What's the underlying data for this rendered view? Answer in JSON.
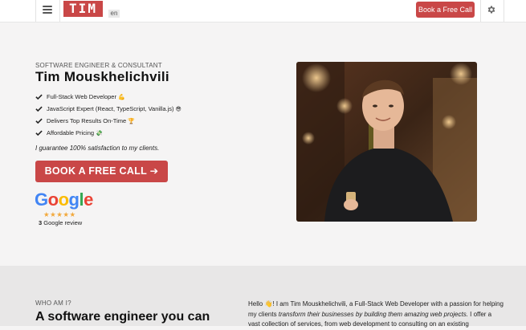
{
  "header": {
    "logo_text": "TIM",
    "lang_badge": "en",
    "cta_label": "Book a Free Call",
    "menu_icon": "hamburger-icon",
    "settings_icon": "gear-icon"
  },
  "hero": {
    "eyebrow": "SOFTWARE ENGINEER & CONSULTANT",
    "name": "Tim Mouskhelichvili",
    "features": [
      {
        "text": "Full-Stack Web Developer",
        "emoji": "💪"
      },
      {
        "text": "JavaScript Expert (React, TypeScript, Vanilla.js)",
        "emoji": "😎"
      },
      {
        "text": "Delivers Top Results On-Time",
        "emoji": "🏆"
      },
      {
        "text": "Affordable Pricing",
        "emoji": "💸"
      }
    ],
    "guarantee": "I guarantee 100% satisfaction to my clients.",
    "cta_label": "BOOK A FREE CALL",
    "cta_arrow": "➔",
    "google_word": "Google",
    "rating_stars": "★★★★★",
    "rating_value": 4.5,
    "review_count": "3",
    "review_label": "Google review"
  },
  "about": {
    "eyebrow": "WHO AM I?",
    "headline": "A software engineer you can",
    "bio_pre": "Hello 👋! I am Tim Mouskhelichvili, a Full-Stack Web Developer with a passion for helping my clients ",
    "bio_em": "transform their businesses by building them amazing web projects.",
    "bio_post": " I offer a vast collection of services, from web development to consulting on an existing"
  },
  "colors": {
    "brand": "#c94747",
    "background": "#f5f4f4",
    "section": "#e8e7e7",
    "star": "#f2a83b",
    "google_blue": "#4285F4",
    "google_red": "#EA4335",
    "google_yellow": "#FBBC05",
    "google_green": "#34A853"
  }
}
